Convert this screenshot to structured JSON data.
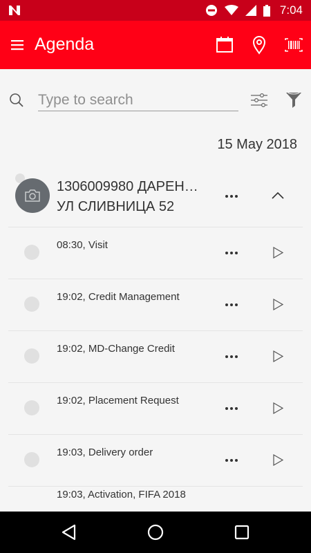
{
  "status_bar": {
    "time": "7:04"
  },
  "app_bar": {
    "title": "Agenda",
    "accent_color": "#ff0016"
  },
  "search": {
    "placeholder": "Type to search",
    "value": ""
  },
  "date_header": "15 May 2018",
  "customer_group": {
    "line1": "1306009980  ДАРЕН…",
    "line2": "УЛ СЛИВНИЦА 52",
    "expanded": true
  },
  "items": [
    {
      "label": "08:30, Visit"
    },
    {
      "label": "19:02, Credit Management"
    },
    {
      "label": "19:02, MD-Change Credit"
    },
    {
      "label": "19:02, Placement Request"
    },
    {
      "label": "19:03, Delivery order"
    }
  ],
  "partial_item": {
    "label": "19:03, Activation, FIFA 2018"
  }
}
